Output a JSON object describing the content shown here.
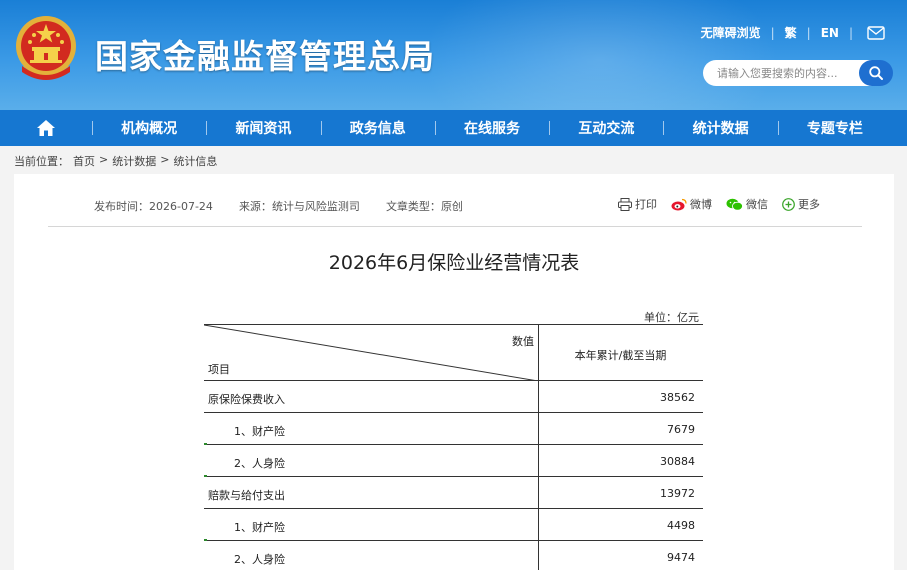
{
  "header": {
    "site_title": "国家金融监督管理总局",
    "links": {
      "accessibility": "无障碍浏览",
      "traditional": "繁",
      "english": "EN"
    },
    "search": {
      "placeholder": "请输入您要搜索的内容..."
    }
  },
  "nav": {
    "items": [
      "机构概况",
      "新闻资讯",
      "政务信息",
      "在线服务",
      "互动交流",
      "统计数据",
      "专题专栏"
    ]
  },
  "breadcrumb": {
    "prefix": "当前位置：",
    "items": [
      "首页",
      "统计数据",
      "统计信息"
    ],
    "separator": ">"
  },
  "article": {
    "publish_label": "发布时间：",
    "publish_date": "2026-07-24",
    "source_label": "来源：",
    "source": "统计与风险监测司",
    "type_label": "文章类型：",
    "type": "原创",
    "share": {
      "print": "打印",
      "weibo": "微博",
      "wechat": "微信",
      "more": "更多"
    },
    "title": "2026年6月保险业经营情况表",
    "unit": "单位：亿元",
    "table": {
      "header_value": "数值",
      "header_item": "项目",
      "column_title": "本年累计/截至当期",
      "rows": [
        {
          "name": "原保险保费收入",
          "value": "38562"
        },
        {
          "name": "1、财产险",
          "value": "7679"
        },
        {
          "name": "2、人身险",
          "value": "30884"
        },
        {
          "name": "赔款与给付支出",
          "value": "13972"
        },
        {
          "name": "1、财产险",
          "value": "4498"
        },
        {
          "name": "2、人身险",
          "value": "9474"
        }
      ]
    }
  },
  "colors": {
    "header_blue": "#1a7fd6",
    "nav_blue": "#1677d1",
    "search_button": "#1e6fd0"
  }
}
